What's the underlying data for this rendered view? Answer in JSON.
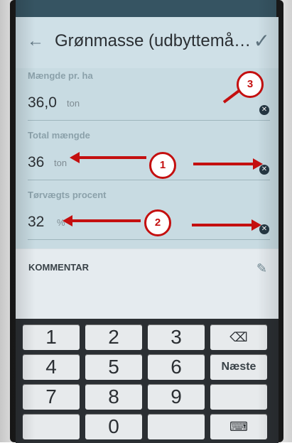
{
  "header": {
    "title": "Grønmasse (udbyttemålin...",
    "back_icon": "back-arrow-icon",
    "confirm_icon": "checkmark-icon"
  },
  "fields": [
    {
      "label": "Mængde pr. ha",
      "value": "36,0",
      "unit": "ton",
      "clear_icon": "clear-icon"
    },
    {
      "label": "Total mængde",
      "value": "36",
      "unit": "ton",
      "clear_icon": "clear-icon"
    },
    {
      "label": "Tørvægts procent",
      "value": "32",
      "unit": "%",
      "clear_icon": "clear-icon"
    }
  ],
  "comment": {
    "label": "KOMMENTAR",
    "edit_icon": "pencil-icon"
  },
  "keyboard": {
    "row1": [
      "1",
      "2",
      "3"
    ],
    "row2": [
      "4",
      "5",
      "6"
    ],
    "row3": [
      "7",
      "8",
      "9"
    ],
    "row4": [
      "0"
    ],
    "next_label": "Næste",
    "backspace_icon": "backspace-icon"
  },
  "callouts": {
    "one": "1",
    "two": "2",
    "three": "3"
  },
  "colors": {
    "accent": "#c40f0f",
    "header": "#cfe0e7",
    "form": "#c8dbe2"
  }
}
